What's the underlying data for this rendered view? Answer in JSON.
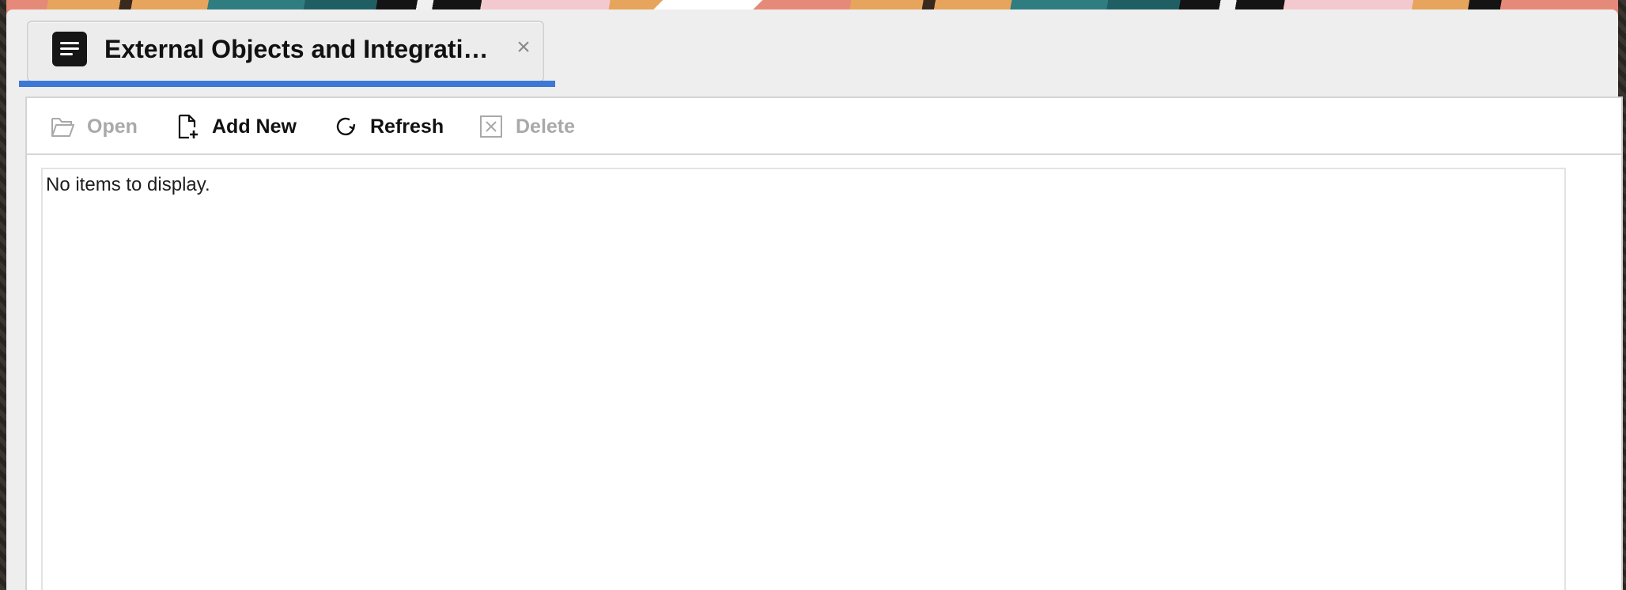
{
  "tab": {
    "title": "External Objects and Integrati…",
    "close_symbol": "×",
    "icon": "menu-lines-icon"
  },
  "toolbar": {
    "open_label": "Open",
    "add_new_label": "Add New",
    "refresh_label": "Refresh",
    "delete_label": "Delete"
  },
  "list": {
    "empty_message": "No items to display."
  },
  "colors": {
    "accent": "#3e78d6",
    "disabled_text": "#a9a9a9",
    "enabled_text": "#111111"
  }
}
